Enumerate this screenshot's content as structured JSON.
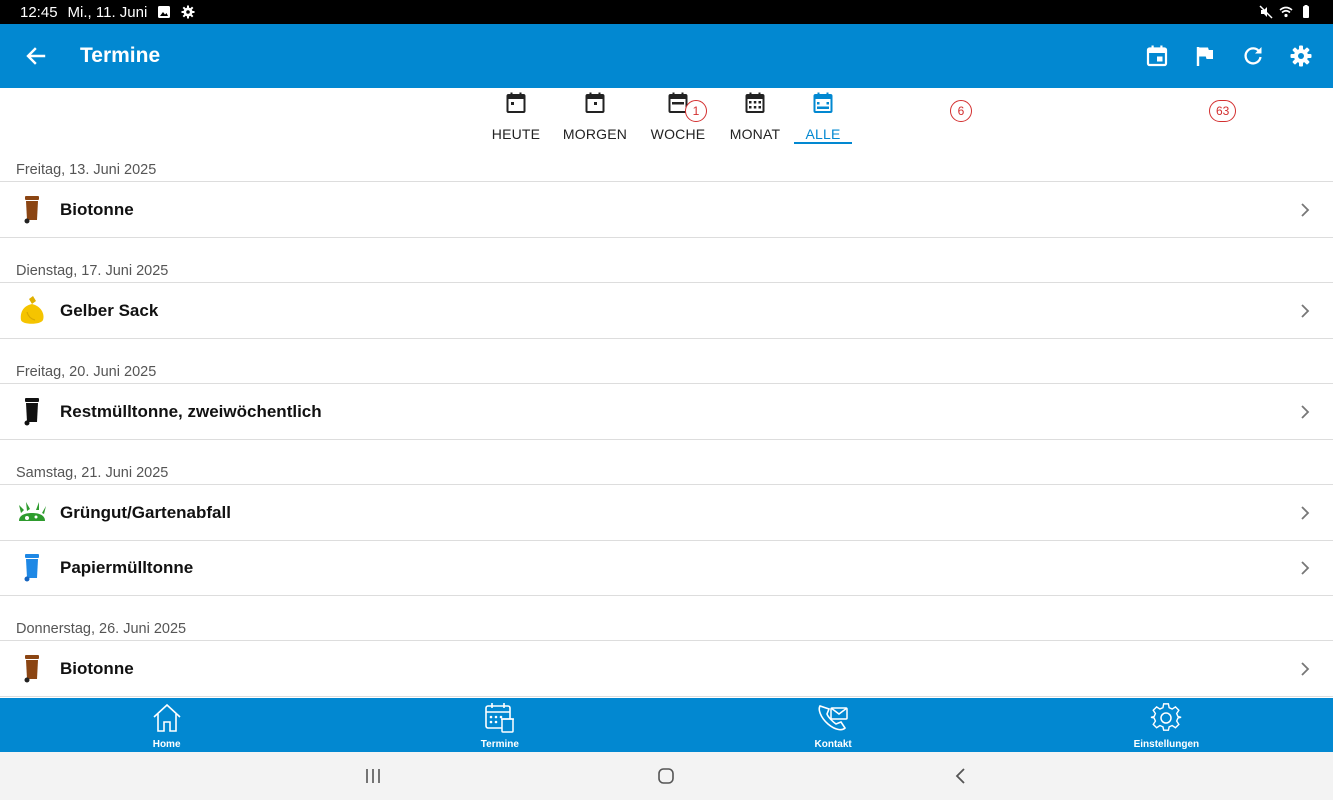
{
  "status": {
    "time": "12:45",
    "date": "Mi., 11. Juni"
  },
  "appbar": {
    "title": "Termine"
  },
  "tabs": [
    {
      "label": "HEUTE"
    },
    {
      "label": "MORGEN"
    },
    {
      "label": "WOCHE",
      "badge": "1"
    },
    {
      "label": "MONAT",
      "badge": "6"
    },
    {
      "label": "ALLE",
      "badge": "63"
    }
  ],
  "active_tab": "ALLE",
  "sections": [
    {
      "date": "Freitag, 13. Juni 2025",
      "items": [
        {
          "label": "Biotonne",
          "icon": "brown-bin-icon"
        }
      ]
    },
    {
      "date": "Dienstag, 17. Juni 2025",
      "items": [
        {
          "label": "Gelber Sack",
          "icon": "yellow-bag-icon"
        }
      ]
    },
    {
      "date": "Freitag, 20. Juni 2025",
      "items": [
        {
          "label": "Restmülltonne, zweiwöchentlich",
          "icon": "black-bin-icon"
        }
      ]
    },
    {
      "date": "Samstag, 21. Juni 2025",
      "items": [
        {
          "label": "Grüngut/Gartenabfall",
          "icon": "green-waste-icon"
        },
        {
          "label": "Papiermülltonne",
          "icon": "blue-bin-icon"
        }
      ]
    },
    {
      "date": "Donnerstag, 26. Juni 2025",
      "items": [
        {
          "label": "Biotonne",
          "icon": "brown-bin-icon"
        }
      ]
    }
  ],
  "bottomnav": {
    "home": "Home",
    "termine": "Termine",
    "kontakt": "Kontakt",
    "einstellungen": "Einstellungen"
  },
  "colors": {
    "primary": "#0288d1",
    "badge": "#d32f2f",
    "bio": "#8b4513",
    "gelb": "#f5c400",
    "rest": "#111111",
    "gruen": "#2e9b2e",
    "papier": "#1e88e5"
  }
}
